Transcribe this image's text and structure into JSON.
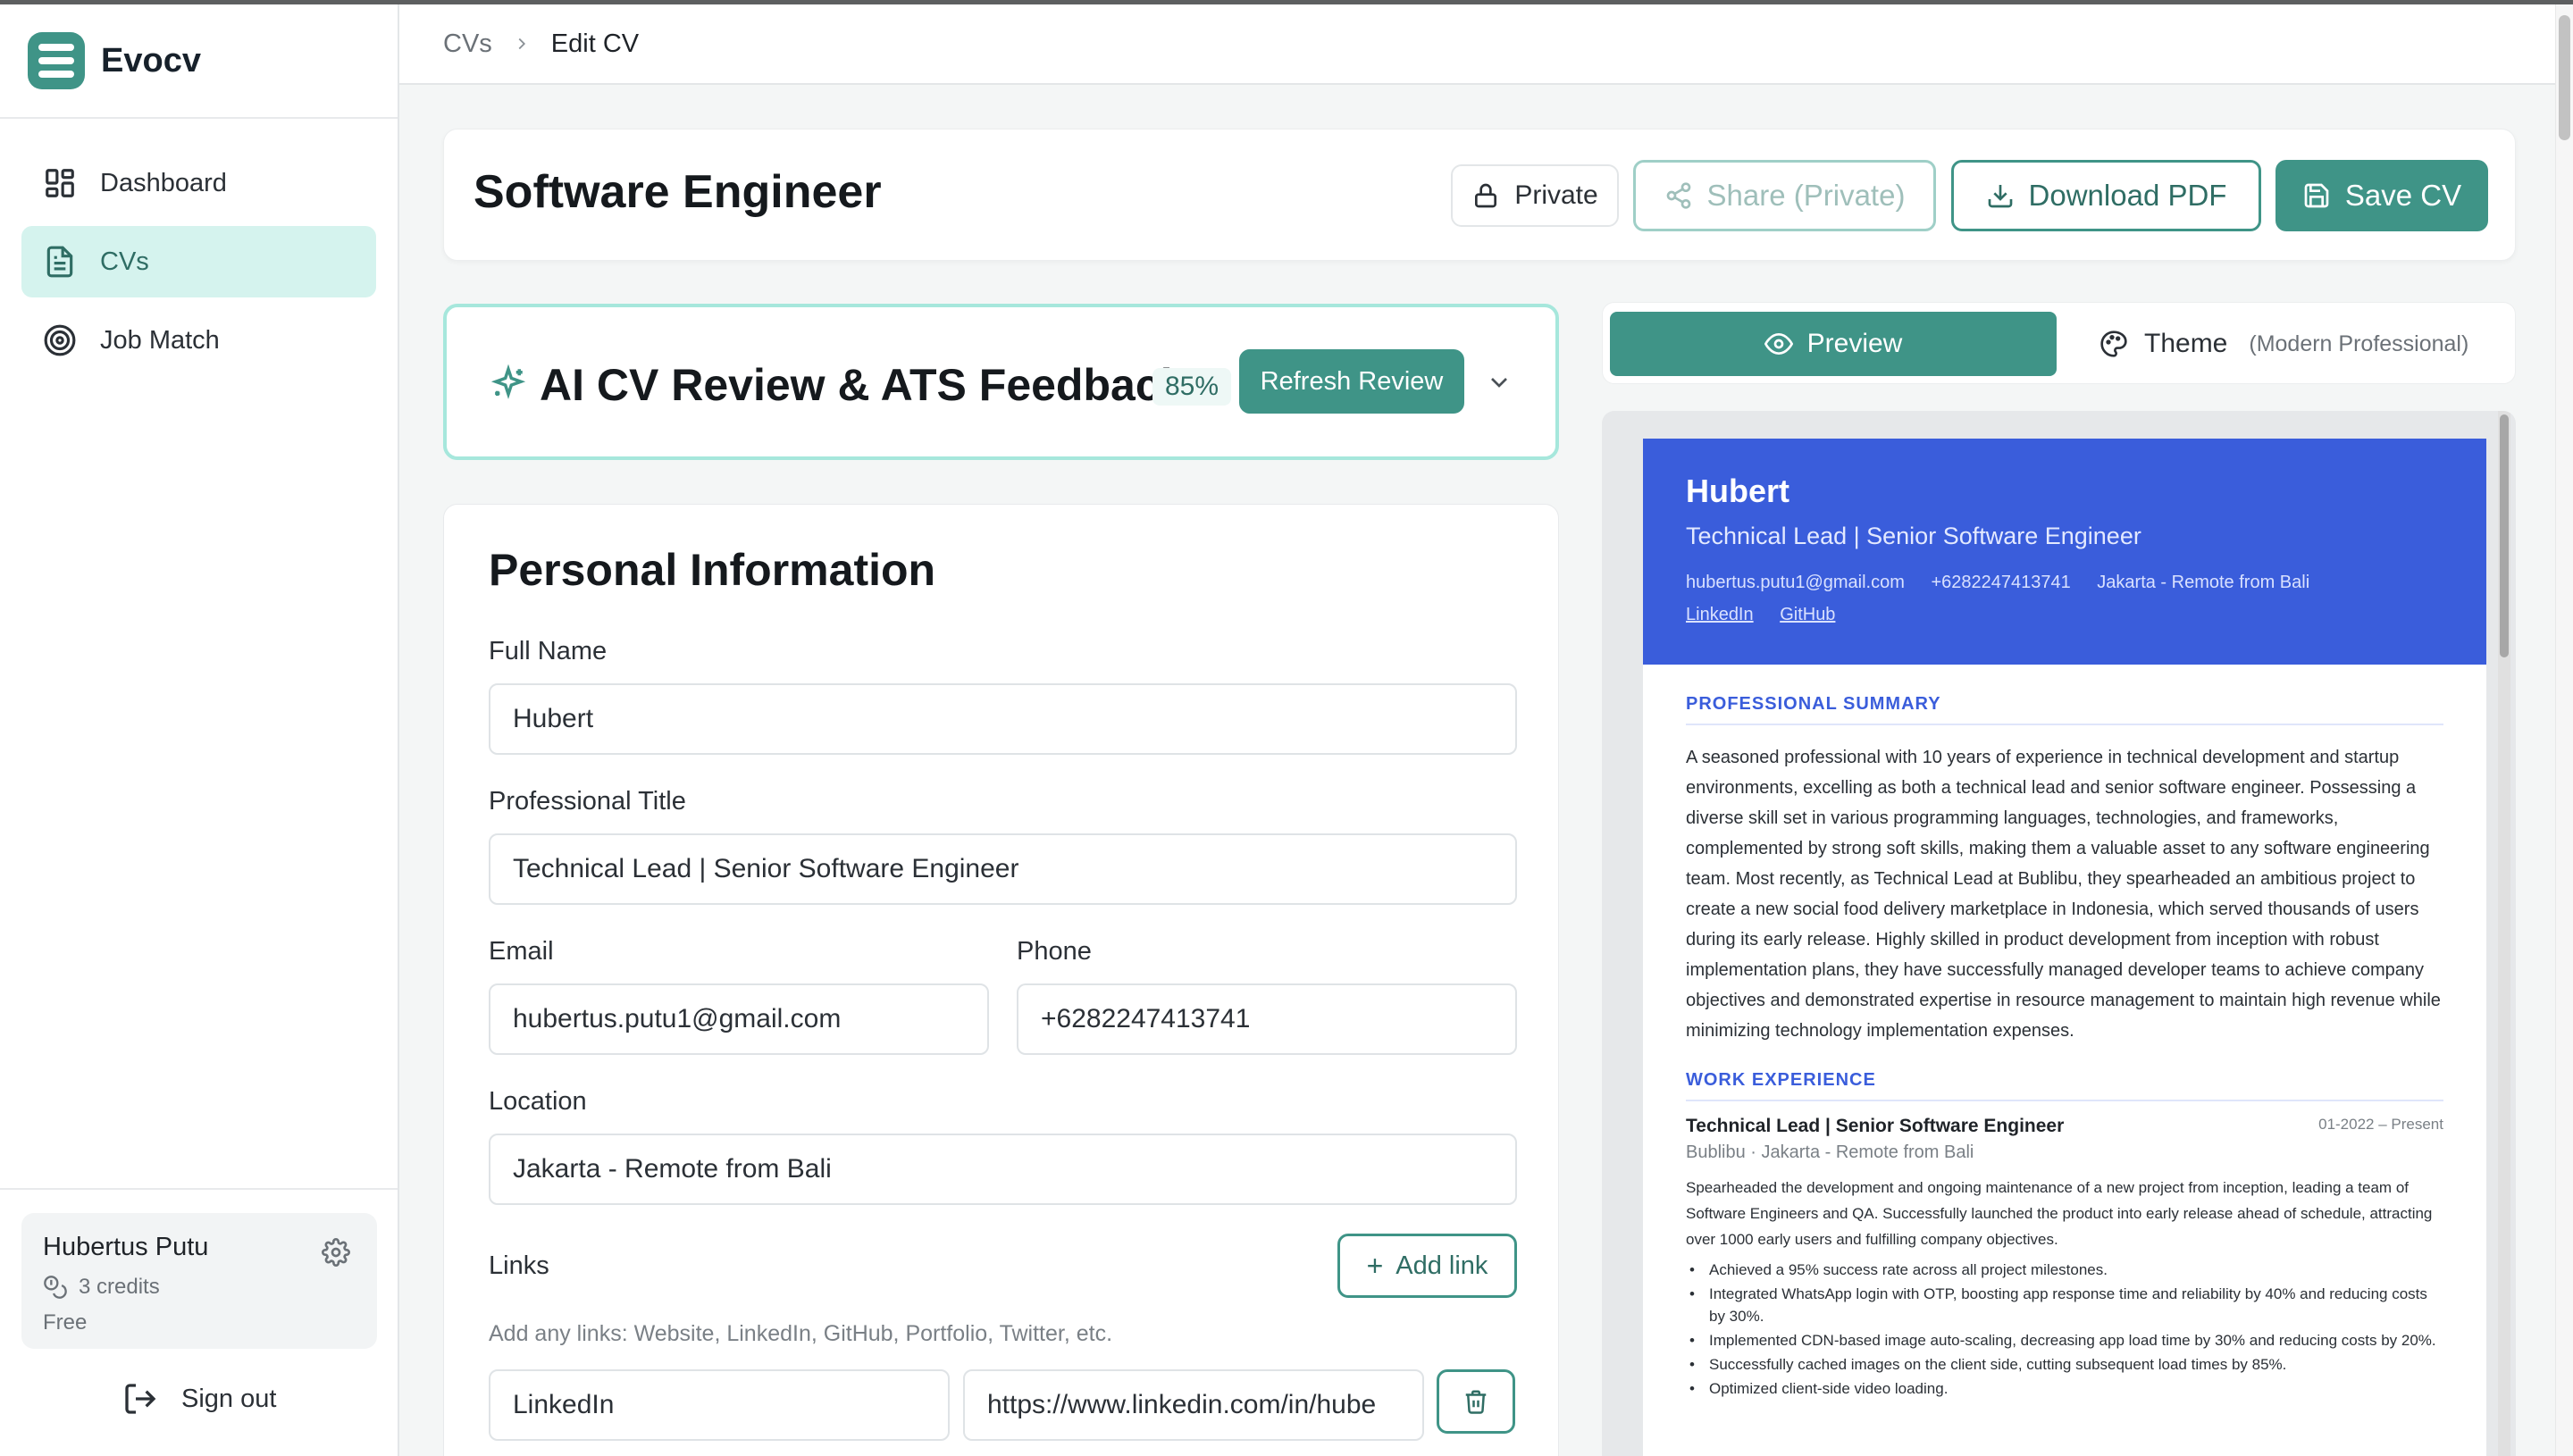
{
  "app": {
    "name": "Evocv"
  },
  "sidebar": {
    "items": [
      {
        "label": "Dashboard"
      },
      {
        "label": "CVs"
      },
      {
        "label": "Job Match"
      }
    ],
    "user": {
      "name": "Hubertus Putu",
      "credits": "3 credits",
      "plan": "Free"
    },
    "signout": "Sign out"
  },
  "breadcrumb": {
    "parent": "CVs",
    "current": "Edit CV"
  },
  "header": {
    "title": "Software Engineer",
    "private_label": "Private",
    "share_label": "Share (Private)",
    "download_label": "Download PDF",
    "save_label": "Save CV"
  },
  "ai_review": {
    "title": "AI CV Review & ATS Feedback",
    "score": "85%",
    "refresh_label": "Refresh Review"
  },
  "personal_info": {
    "title": "Personal Information",
    "full_name_label": "Full Name",
    "full_name": "Hubert",
    "professional_title_label": "Professional Title",
    "professional_title": "Technical Lead | Senior Software Engineer",
    "email_label": "Email",
    "email": "hubertus.putu1@gmail.com",
    "phone_label": "Phone",
    "phone": "+6282247413741",
    "location_label": "Location",
    "location": "Jakarta - Remote from Bali",
    "links_label": "Links",
    "add_link_label": "Add link",
    "links_hint": "Add any links: Website, LinkedIn, GitHub, Portfolio, Twitter, etc.",
    "link_name": "LinkedIn",
    "link_url": "https://www.linkedin.com/in/hube"
  },
  "preview_panel": {
    "preview_tab": "Preview",
    "theme_tab": "Theme",
    "theme_name": "(Modern Professional)"
  },
  "cv_preview": {
    "name": "Hubert",
    "title": "Technical Lead | Senior Software Engineer",
    "email": "hubertus.putu1@gmail.com",
    "phone": "+6282247413741",
    "location": "Jakarta - Remote from Bali",
    "links": [
      "LinkedIn",
      "GitHub"
    ],
    "summary_heading": "PROFESSIONAL SUMMARY",
    "summary": "A seasoned professional with 10 years of experience in technical development and startup environments, excelling as both a technical lead and senior software engineer. Possessing a diverse skill set in various programming languages, technologies, and frameworks, complemented by strong soft skills, making them a valuable asset to any software engineering team. Most recently, as Technical Lead at Bublibu, they spearheaded an ambitious project to create a new social food delivery marketplace in Indonesia, which served thousands of users during its early release. Highly skilled in product development from inception with robust implementation plans, they have successfully managed developer teams to achieve company objectives and demonstrated expertise in resource management to maintain high revenue while minimizing technology implementation expenses.",
    "experience_heading": "WORK EXPERIENCE",
    "job": {
      "title": "Technical Lead | Senior Software Engineer",
      "dates": "01-2022 – Present",
      "company": "Bublibu · Jakarta - Remote from Bali",
      "description": "Spearheaded the development and ongoing maintenance of a new project from inception, leading a team of Software Engineers and QA. Successfully launched the product into early release ahead of schedule, attracting over 1000 early users and fulfilling company objectives.",
      "bullets": [
        "Achieved a 95% success rate across all project milestones.",
        "Integrated WhatsApp login with OTP, boosting app response time and reliability by 40% and reducing costs by 30%.",
        "Implemented CDN-based image auto-scaling, decreasing app load time by 30% and reducing costs by 20%.",
        "Successfully cached images on the client side, cutting subsequent load times by 85%.",
        "Optimized client-side video loading."
      ]
    }
  },
  "colors": {
    "accent": "#3f9487",
    "accent_light": "#d5f3ee",
    "cv_header": "#3a5ddb"
  },
  "icons": [
    "logo-icon",
    "dashboard-icon",
    "file-icon",
    "target-icon",
    "coins-icon",
    "gear-icon",
    "signout-icon",
    "chevron-right-icon",
    "lock-icon",
    "share-icon",
    "download-icon",
    "save-icon",
    "sparkle-icon",
    "chevron-down-icon",
    "plus-icon",
    "trash-icon",
    "eye-icon",
    "palette-icon"
  ]
}
